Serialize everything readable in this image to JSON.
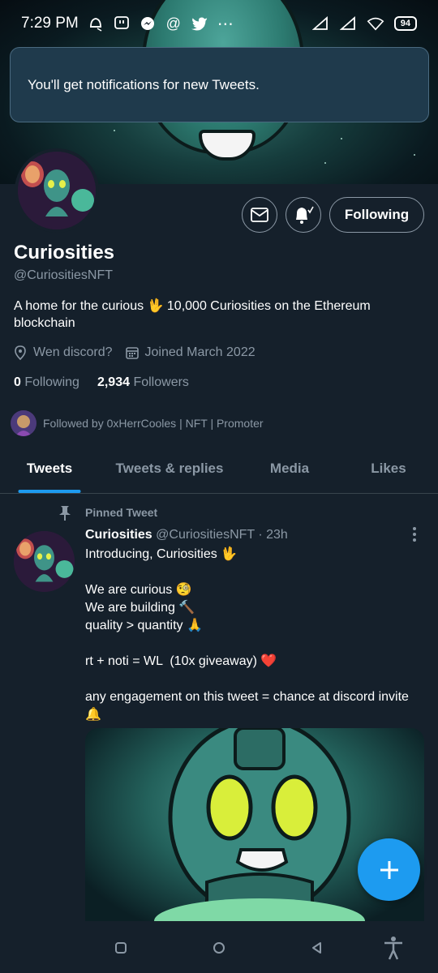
{
  "status_bar": {
    "time": "7:29 PM",
    "battery": "94",
    "icons": [
      "alarm-off-icon",
      "twitch-icon",
      "messenger-icon",
      "at-icon",
      "twitter-icon",
      "more-icon",
      "signal-icon",
      "signal-icon",
      "wifi-icon"
    ]
  },
  "toast": {
    "message": "You'll get notifications for new Tweets."
  },
  "profile": {
    "name": "Curiosities",
    "handle": "@CuriositiesNFT",
    "bio": "A home for the curious 🖖 10,000 Curiosities on the Ethereum blockchain",
    "location": "Wen discord?",
    "joined": "Joined March 2022",
    "following_count": "0",
    "following_label": "Following",
    "followers_count": "2,934",
    "followers_label": "Followers",
    "followed_by": "Followed by 0xHerrCooles | NFT | Promoter",
    "follow_button": "Following"
  },
  "tabs": [
    {
      "label": "Tweets",
      "active": true
    },
    {
      "label": "Tweets & replies",
      "active": false
    },
    {
      "label": "Media",
      "active": false
    },
    {
      "label": "Likes",
      "active": false
    }
  ],
  "tweet": {
    "pinned_label": "Pinned Tweet",
    "author_name": "Curiosities",
    "author_handle": "@CuriositiesNFT",
    "time": "· 23h",
    "text": "Introducing, Curiosities 🖖\n\nWe are curious 🧐\nWe are building 🔨\nquality > quantity 🙏\n\nrt + noti = WL  (10x giveaway) ❤️\n\nany engagement on this tweet = chance at discord invite 🔔"
  },
  "colors": {
    "background": "#15202b",
    "accent": "#1d9bf0",
    "secondary_text": "#8b98a5",
    "toast_bg": "#1f3a4c"
  }
}
